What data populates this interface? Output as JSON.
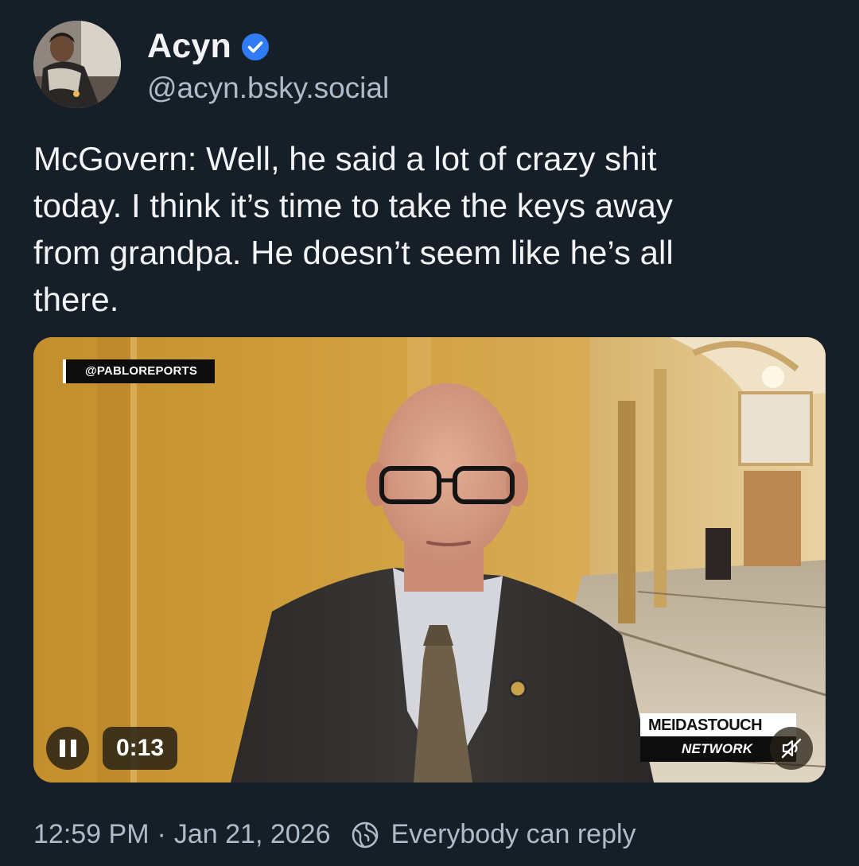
{
  "author": {
    "display_name": "Acyn",
    "handle": "@acyn.bsky.social",
    "verified": true,
    "avatar_icon": "user-avatar-photo"
  },
  "post": {
    "text": "McGovern: Well, he said a lot of crazy shit\ntoday. I think it’s time to take the keys away\nfrom grandpa. He doesn’t seem like he’s all\nthere."
  },
  "video": {
    "watermark_top": "@PABLOREPORTS",
    "time": "0:13",
    "network_line1": "MEIDASTOUCH",
    "network_line2": "NETWORK",
    "state": "playing",
    "muted": true
  },
  "footer": {
    "time": "12:59 PM",
    "separator": "·",
    "date": "Jan 21, 2026",
    "reply_setting": "Everybody can reply"
  },
  "colors": {
    "background": "#161e27",
    "text_primary": "#f1f3f5",
    "text_secondary": "#aebbc9",
    "verified_blue": "#2f7cf6"
  }
}
